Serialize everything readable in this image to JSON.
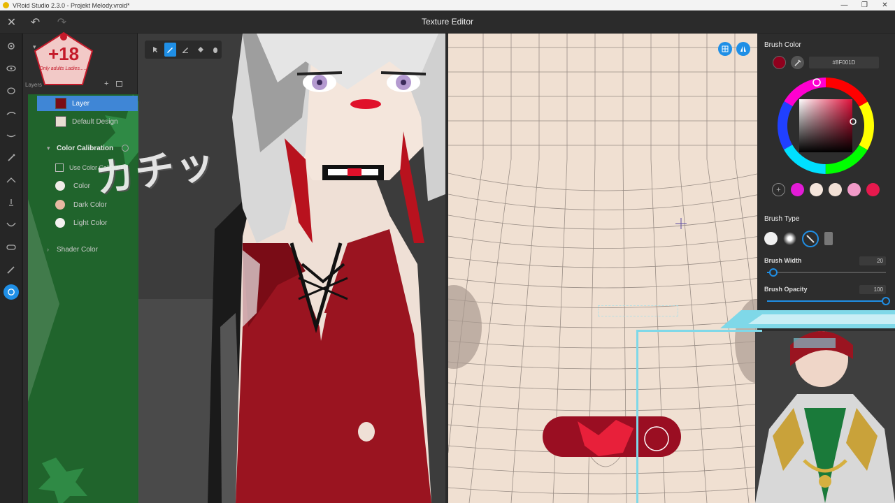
{
  "window": {
    "title": "VRoid Studio 2.3.0 - Projekt Melody.vroid*",
    "controls": [
      "—",
      "❐",
      "✕"
    ]
  },
  "header": {
    "title": "Texture Editor",
    "close_glyph": "✕",
    "undo_glyph": "↶",
    "redo_glyph": "↷"
  },
  "overlay": {
    "age_rating": "+18",
    "age_subtitle": "Only adults Ladies......",
    "sfx_text": "カチッ"
  },
  "layers_panel": {
    "heading": "Layers",
    "add_glyph": "+",
    "rows": [
      {
        "label": "Layer",
        "selected": true
      },
      {
        "label": "Default Design",
        "selected": false
      }
    ],
    "color_calibration": {
      "title": "Color Calibration",
      "use_checkbox_label": "Use Color Calibration",
      "items": [
        {
          "label": "Color",
          "swatch": "#f0ece8"
        },
        {
          "label": "Dark Color",
          "swatch": "#e8b9a3"
        },
        {
          "label": "Light Color",
          "swatch": "#f4f2f0"
        }
      ]
    },
    "shader_color": "Shader Color"
  },
  "brush": {
    "color_title": "Brush Color",
    "hex_value": "#8F001D",
    "current_color": "#8f001d",
    "palette": [
      "#e31bd6",
      "#f5e6dc",
      "#f2e0d5",
      "#f19ac8",
      "#e6194d"
    ],
    "type_title": "Brush Type",
    "width_label": "Brush Width",
    "width_value": "20",
    "width_fraction": 0.05,
    "opacity_label": "Brush Opacity",
    "opacity_value": "100",
    "opacity_fraction": 1.0
  },
  "colors": {
    "accent": "#1f8fe6",
    "body_red": "#9a1420",
    "skin": "#f0e0d2"
  }
}
